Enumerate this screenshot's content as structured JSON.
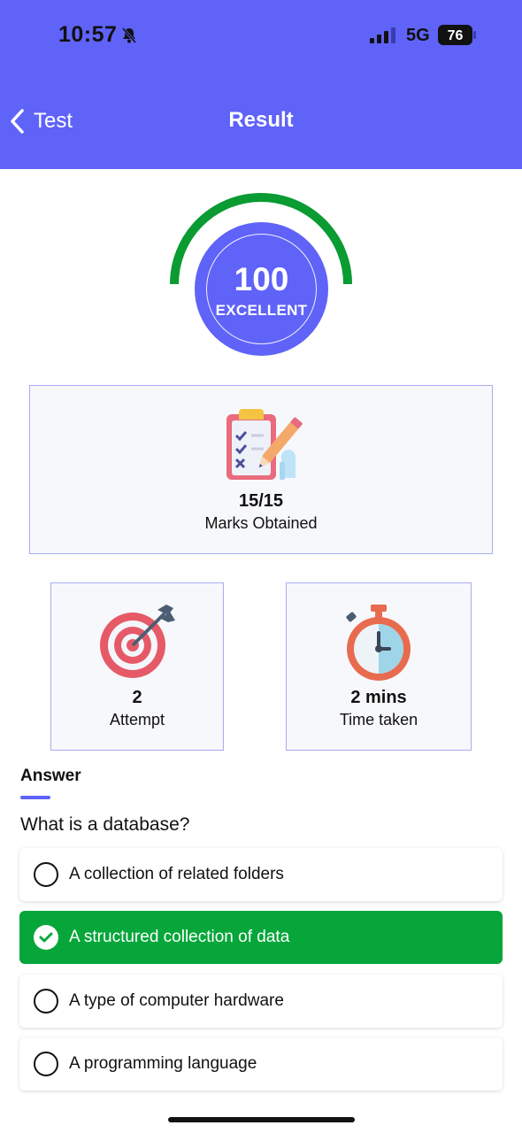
{
  "status_bar": {
    "time": "10:57",
    "network": "5G",
    "battery": "76",
    "icons": [
      "bell-slash-icon",
      "signal-icon",
      "battery-icon"
    ]
  },
  "nav": {
    "back_label": "Test",
    "title": "Result"
  },
  "score": {
    "value": "100",
    "label": "EXCELLENT",
    "gauge_fraction": 1.0,
    "colors": {
      "gauge": "#0a9b32",
      "circle": "#5f63f8"
    }
  },
  "marks": {
    "icon": "clipboard-checklist-icon",
    "value": "15/15",
    "label": "Marks Obtained"
  },
  "attempt": {
    "icon": "target-icon",
    "value": "2",
    "label": "Attempt"
  },
  "time_taken": {
    "icon": "stopwatch-icon",
    "value": "2 mins",
    "label": "Time taken"
  },
  "answer": {
    "heading": "Answer",
    "question": "What is a database?",
    "options": [
      {
        "text": "A collection of related folders",
        "correct": false
      },
      {
        "text": "A structured collection of data",
        "correct": true
      },
      {
        "text": "A type of computer hardware",
        "correct": false
      },
      {
        "text": "A programming language",
        "correct": false
      }
    ]
  },
  "colors": {
    "header": "#5f63f8",
    "correct": "#06a63a",
    "card_border": "#a9abf2"
  }
}
